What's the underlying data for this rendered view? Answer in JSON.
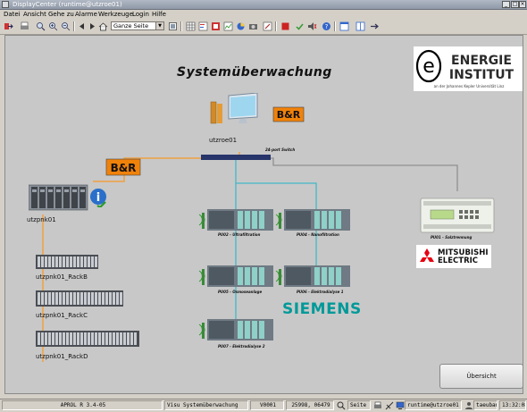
{
  "window": {
    "title": "DisplayCenter (runtime@utzroe01)"
  },
  "menu": [
    {
      "label": "Datei"
    },
    {
      "label": "Ansicht"
    },
    {
      "label": "Gehe zu"
    },
    {
      "label": "Alarme"
    },
    {
      "label": "Werkzeuge"
    },
    {
      "label": "Login"
    },
    {
      "label": "Hilfe"
    }
  ],
  "toolbar": {
    "zoom_value": "Ganze Seite"
  },
  "canvas": {
    "title": "Systemüberwachung",
    "workstation_label": "utzroe01",
    "switch_label": "24-port Switch",
    "plc_label": "utzpnk01",
    "racks": [
      "utzpnk01_RackB",
      "utzpnk01_RackC",
      "utzpnk01_RackD"
    ],
    "stations": [
      {
        "label": "PU02 - Ultrafiltration"
      },
      {
        "label": "PU04 - Nanofiltration"
      },
      {
        "label": "PU05 - Osmoseanlage"
      },
      {
        "label": "PU06 - Elektrodialyse 1"
      },
      {
        "label": "PU07 - Elektrodialyse 2"
      }
    ],
    "mitsubishi_unit_label": "PU01 - Salztrennung",
    "logos": {
      "energie_line1": "ENERGIE",
      "energie_line2": "INSTITUT",
      "energie_sub": "an der Johannes Kepler Universität Linz",
      "siemens": "SIEMENS",
      "mitsubishi_line1": "MITSUBISHI",
      "mitsubishi_line2": "ELECTRIC",
      "bnr": "B&R"
    },
    "nav_button": "Übersicht"
  },
  "status": {
    "version": "APROL R 3.4-05",
    "view": "Visu Systemüberwachung",
    "code": "V0001",
    "coords": "25998, 06479",
    "page_label": "Seite",
    "user": "runtime@utzroe01",
    "login": "taeuban",
    "time": "13:32:08"
  },
  "colors": {
    "canvas_bg": "#c8c8c8",
    "bnr_orange": "#f0820a",
    "ethernet_orange": "#f0a040",
    "fieldbus_cyan": "#40b8c8",
    "serial_gray": "#909090",
    "switch_navy": "#27356b",
    "siemens_teal": "#009999",
    "mitsubishi_red": "#e60012"
  }
}
